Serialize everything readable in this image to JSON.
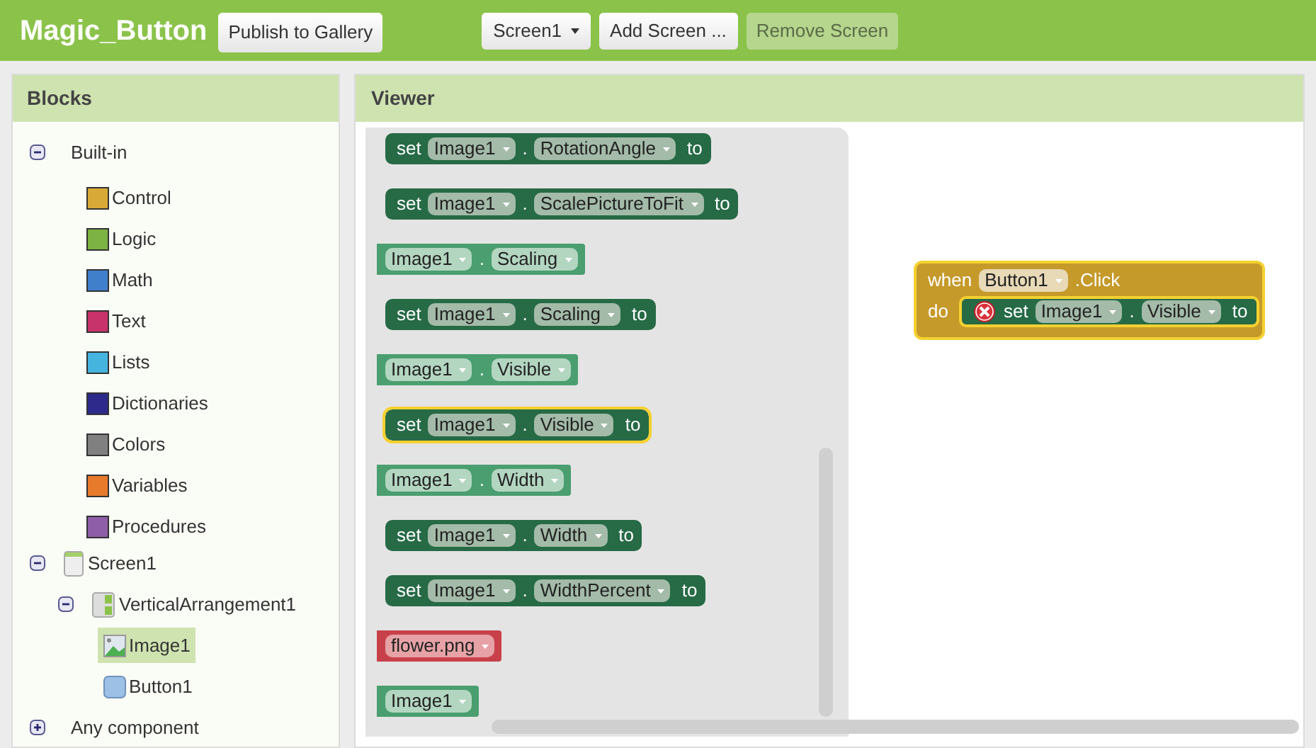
{
  "header": {
    "title": "Magic_Button",
    "publish_button": "Publish to Gallery",
    "screen_dropdown": "Screen1",
    "add_screen_button": "Add Screen ...",
    "remove_screen_button": {
      "label": "Remove Screen",
      "disabled": true
    }
  },
  "blocks_panel": {
    "title": "Blocks",
    "tree": [
      {
        "label": "Built-in",
        "kind": "group",
        "expanded": true,
        "children": [
          {
            "label": "Control",
            "kind": "category",
            "color": "#d9a938"
          },
          {
            "label": "Logic",
            "kind": "category",
            "color": "#7cb342"
          },
          {
            "label": "Math",
            "kind": "category",
            "color": "#3f7fcc"
          },
          {
            "label": "Text",
            "kind": "category",
            "color": "#c8336b"
          },
          {
            "label": "Lists",
            "kind": "category",
            "color": "#45b5e0"
          },
          {
            "label": "Dictionaries",
            "kind": "category",
            "color": "#2d2a8c"
          },
          {
            "label": "Colors",
            "kind": "category",
            "color": "#808080"
          },
          {
            "label": "Variables",
            "kind": "category",
            "color": "#e87a2c"
          },
          {
            "label": "Procedures",
            "kind": "category",
            "color": "#8f5ea8"
          }
        ]
      },
      {
        "label": "Screen1",
        "kind": "screen",
        "expanded": true,
        "children": [
          {
            "label": "VerticalArrangement1",
            "kind": "arrangement",
            "expanded": true,
            "children": [
              {
                "label": "Image1",
                "kind": "image",
                "selected": true
              },
              {
                "label": "Button1",
                "kind": "button",
                "selected": false
              }
            ]
          }
        ]
      },
      {
        "label": "Any component",
        "kind": "group",
        "expanded": false
      }
    ]
  },
  "viewer": {
    "title": "Viewer",
    "flyout": [
      {
        "kind": "setter",
        "verb": "set",
        "component": "Image1",
        "separator": ".",
        "property": "RotationAngle",
        "to": "to",
        "selected": false
      },
      {
        "kind": "setter",
        "verb": "set",
        "component": "Image1",
        "separator": ".",
        "property": "ScalePictureToFit",
        "to": "to",
        "selected": false
      },
      {
        "kind": "getter",
        "component": "Image1",
        "separator": ".",
        "property": "Scaling"
      },
      {
        "kind": "setter",
        "verb": "set",
        "component": "Image1",
        "separator": ".",
        "property": "Scaling",
        "to": "to",
        "selected": false
      },
      {
        "kind": "getter",
        "component": "Image1",
        "separator": ".",
        "property": "Visible"
      },
      {
        "kind": "setter",
        "verb": "set",
        "component": "Image1",
        "separator": ".",
        "property": "Visible",
        "to": "to",
        "selected": true
      },
      {
        "kind": "getter",
        "component": "Image1",
        "separator": ".",
        "property": "Width"
      },
      {
        "kind": "setter",
        "verb": "set",
        "component": "Image1",
        "separator": ".",
        "property": "Width",
        "to": "to",
        "selected": false
      },
      {
        "kind": "setter",
        "verb": "set",
        "component": "Image1",
        "separator": ".",
        "property": "WidthPercent",
        "to": "to",
        "selected": false
      },
      {
        "kind": "asset",
        "component": "flower.png"
      },
      {
        "kind": "component",
        "component": "Image1"
      }
    ],
    "event_block": {
      "when": "when",
      "component": "Button1",
      "event": ".Click",
      "do": "do",
      "statement": {
        "verb": "set",
        "component": "Image1",
        "separator": ".",
        "property": "Visible",
        "to": "to",
        "error": true
      }
    }
  }
}
